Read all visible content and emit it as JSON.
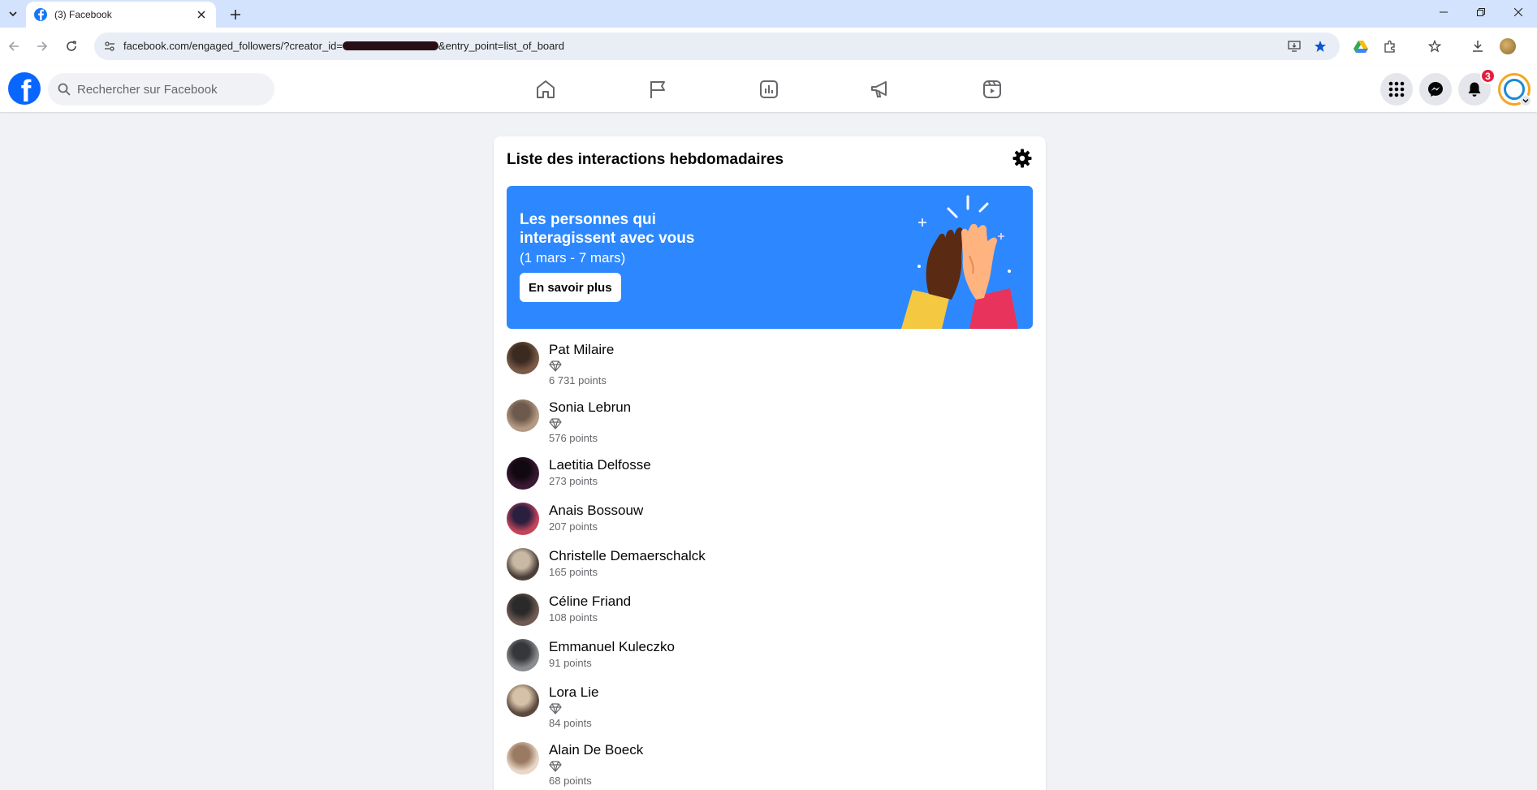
{
  "browser": {
    "tab_title": "(3) Facebook",
    "url_prefix": "facebook.com/engaged_followers/?creator_id=",
    "url_suffix": "&entry_point=list_of_board"
  },
  "fb": {
    "search_placeholder": "Rechercher sur Facebook",
    "notification_count": "3",
    "brand_color": "#0866ff"
  },
  "card": {
    "title": "Liste des interactions hebdomadaires",
    "banner_title": "Les personnes qui interagissent avec vous",
    "banner_period": "(1 mars - 7 mars)",
    "banner_button": "En savoir plus"
  },
  "followers": [
    {
      "name": "Pat Milaire",
      "points": "6 731 points",
      "top_fan": true
    },
    {
      "name": "Sonia Lebrun",
      "points": "576 points",
      "top_fan": true
    },
    {
      "name": "Laetitia Delfosse",
      "points": "273 points",
      "top_fan": false
    },
    {
      "name": "Anais Bossouw",
      "points": "207 points",
      "top_fan": false
    },
    {
      "name": "Christelle Demaerschalck",
      "points": "165 points",
      "top_fan": false
    },
    {
      "name": "Céline Friand",
      "points": "108 points",
      "top_fan": false
    },
    {
      "name": "Emmanuel Kuleczko",
      "points": "91 points",
      "top_fan": false
    },
    {
      "name": "Lora Lie",
      "points": "84 points",
      "top_fan": true
    },
    {
      "name": "Alain De Boeck",
      "points": "68 points",
      "top_fan": true
    }
  ]
}
